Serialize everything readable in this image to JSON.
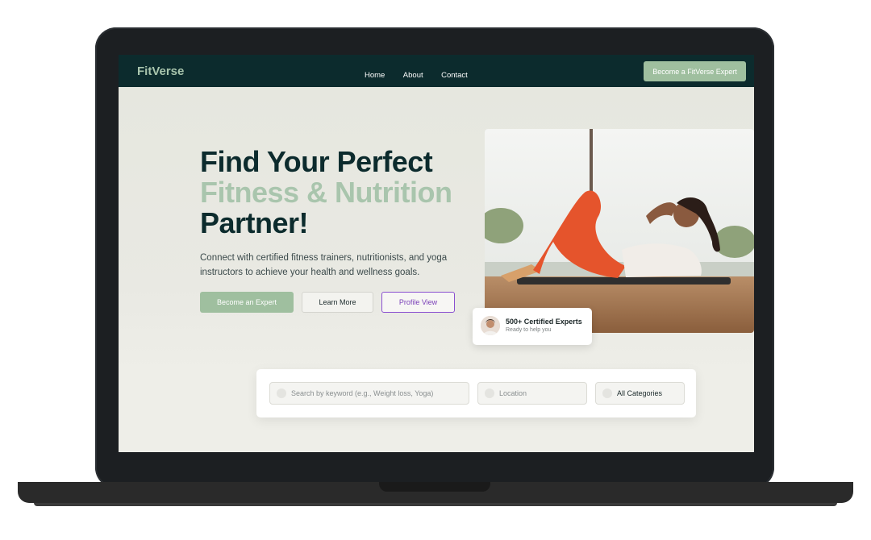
{
  "brand": "FitVerse",
  "nav": {
    "links": [
      "Home",
      "About",
      "Contact"
    ],
    "cta": "Become a FitVerse Expert"
  },
  "hero": {
    "line1": "Find Your Perfect",
    "line2": "Fitness & Nutrition",
    "line3": "Partner!",
    "subtext": "Connect with certified fitness trainers, nutritionists, and yoga instructors to achieve your health and wellness goals.",
    "btn_expert": "Become an Expert",
    "btn_learn": "Learn More",
    "btn_profile": "Profile View"
  },
  "badge": {
    "title": "500+ Certified Experts",
    "subtitle": "Ready to help you"
  },
  "search": {
    "keyword_placeholder": "Search by keyword (e.g., Weight loss, Yoga)",
    "location_placeholder": "Location",
    "category_value": "All Categories"
  },
  "colors": {
    "nav_bg": "#0c2b2d",
    "accent_green": "#9fbf9f",
    "heading_dark": "#0c2b2d",
    "profile_purple": "#8a4fd0"
  }
}
